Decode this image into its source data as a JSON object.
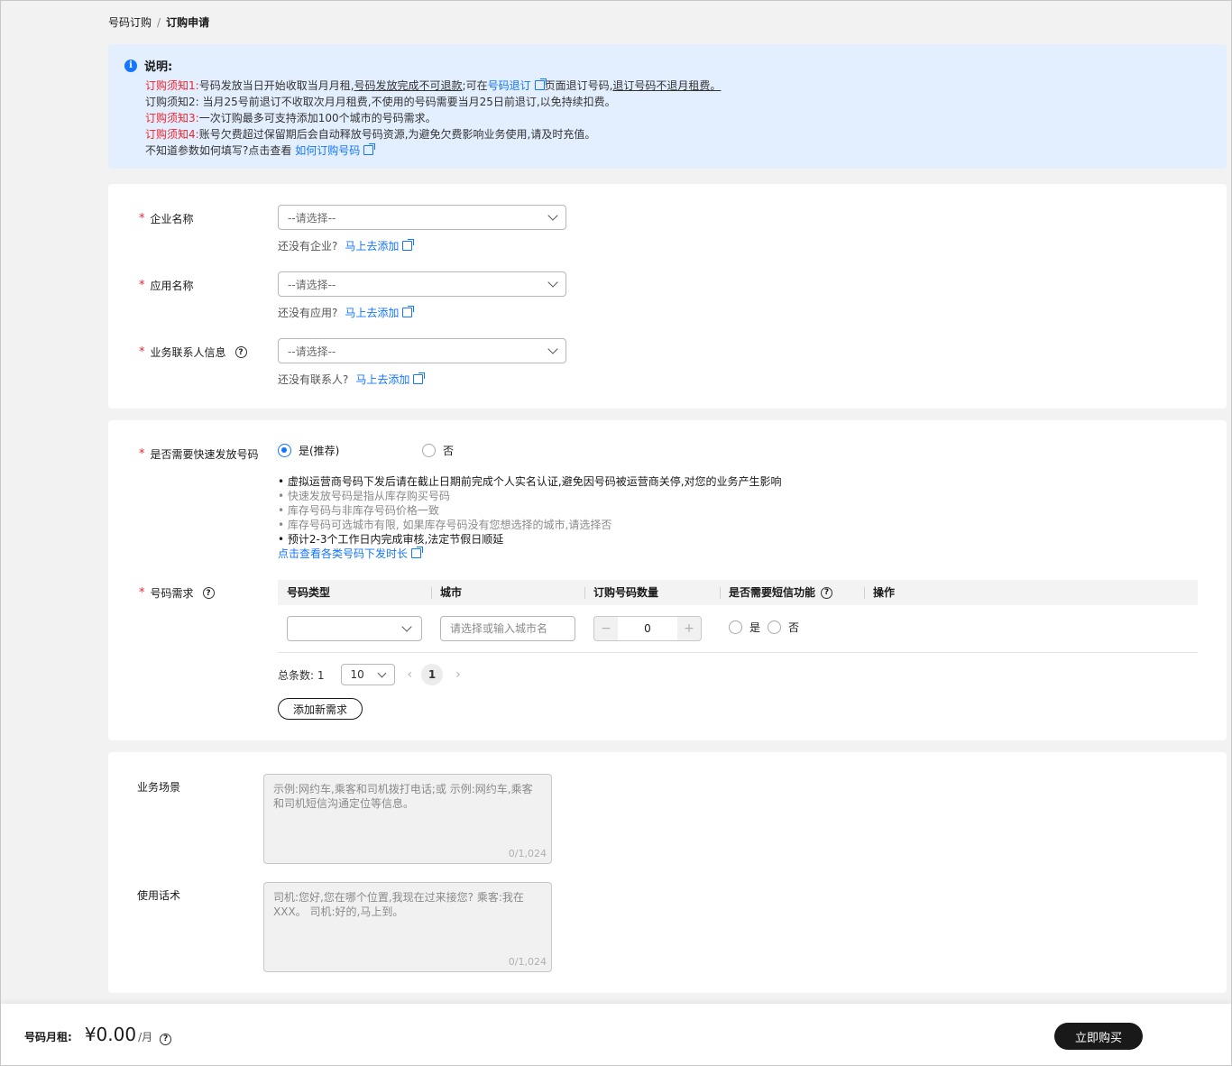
{
  "breadcrumb": {
    "parent": "号码订购",
    "separator": "/",
    "current": "订购申请"
  },
  "notice": {
    "title": "说明:",
    "line1_prefix": "订购须知1:",
    "line1_a": "号码发放当日开始收取当月月租,",
    "line1_b": "号码发放完成不可退款",
    "line1_c": ";可在",
    "line1_link": "号码退订",
    "line1_d": "页面退订号码,",
    "line1_e": "退订号码不退月租费。",
    "line2": "订购须知2: 当月25号前退订不收取次月月租费,不使用的号码需要当月25日前退订,以免持续扣费。",
    "line3_prefix": "订购须知3:",
    "line3": "一次订购最多可支持添加100个城市的号码需求。",
    "line4_prefix": "订购须知4:",
    "line4": "账号欠费超过保留期后会自动释放号码资源,为避免欠费影响业务使用,请及时充值。",
    "line5": "不知道参数如何填写?点击查看",
    "line5_link": "如何订购号码"
  },
  "form": {
    "company": {
      "label": "企业名称",
      "placeholder": "--请选择--",
      "hint": "还没有企业?",
      "hint_link": "马上去添加"
    },
    "app": {
      "label": "应用名称",
      "placeholder": "--请选择--",
      "hint": "还没有应用?",
      "hint_link": "马上去添加"
    },
    "contact": {
      "label": "业务联系人信息",
      "placeholder": "--请选择--",
      "hint": "还没有联系人?",
      "hint_link": "马上去添加"
    },
    "fast": {
      "label": "是否需要快速发放号码",
      "yes": "是(推荐)",
      "no": "否",
      "selected": "yes",
      "bullets": [
        "• 虚拟运营商号码下发后请在截止日期前完成个人实名认证,避免因号码被运营商关停,对您的业务产生影响",
        "• 快速发放号码是指从库存购买号码",
        "• 库存号码与非库存号码价格一致",
        "• 库存号码可选城市有限, 如果库存号码没有您想选择的城市,请选择否",
        "• 预计2-3个工作日内完成审核,法定节假日顺延"
      ],
      "link": "点击查看各类号码下发时长"
    },
    "demand": {
      "label": "号码需求",
      "columns": [
        "号码类型",
        "城市",
        "订购号码数量",
        "是否需要短信功能",
        "操作"
      ],
      "row": {
        "type": "",
        "city_placeholder": "请选择或输入城市名",
        "quantity": "0",
        "sms_yes": "是",
        "sms_no": "否"
      },
      "total_label": "总条数: 1",
      "page_size": "10",
      "current_page": "1",
      "add_button": "添加新需求"
    },
    "scenario": {
      "label": "业务场景",
      "placeholder": "示例:网约车,乘客和司机拨打电话;或 示例:网约车,乘客和司机短信沟通定位等信息。",
      "counter": "0/1,024"
    },
    "script": {
      "label": "使用话术",
      "placeholder": "司机:您好,您在哪个位置,我现在过来接您? 乘客:我在XXX。 司机:好的,马上到。",
      "counter": "0/1,024"
    }
  },
  "footer": {
    "label": "号码月租:",
    "amount": "¥0.00",
    "unit": "/月",
    "buy_button": "立即购买"
  },
  "colors": {
    "accent": "#1476ff",
    "danger": "#f2232e",
    "notice_bg": "#e3effe",
    "primary_button": "#191919"
  }
}
